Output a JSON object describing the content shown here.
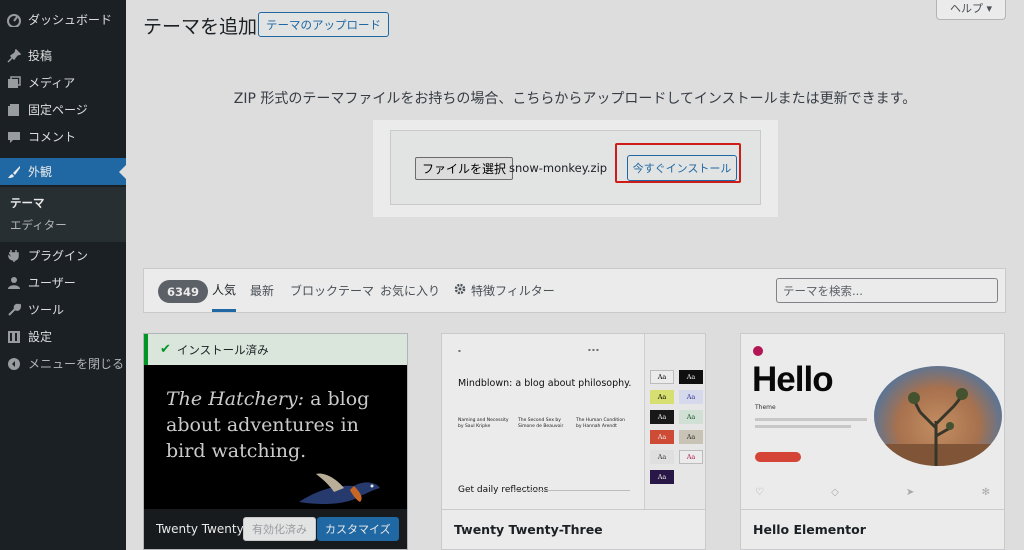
{
  "sidebar": {
    "items": [
      {
        "label": "ダッシュボード",
        "icon": "dashboard-icon"
      },
      {
        "label": "投稿",
        "icon": "pin-icon"
      },
      {
        "label": "メディア",
        "icon": "media-icon"
      },
      {
        "label": "固定ページ",
        "icon": "page-icon"
      },
      {
        "label": "コメント",
        "icon": "comment-icon"
      },
      {
        "label": "外観",
        "icon": "brush-icon"
      },
      {
        "label": "プラグイン",
        "icon": "plugin-icon"
      },
      {
        "label": "ユーザー",
        "icon": "user-icon"
      },
      {
        "label": "ツール",
        "icon": "wrench-icon"
      },
      {
        "label": "設定",
        "icon": "settings-icon"
      },
      {
        "label": "メニューを閉じる",
        "icon": "collapse-icon"
      }
    ],
    "submenu": [
      "テーマ",
      "エディター"
    ],
    "accent": "#2271b1"
  },
  "header": {
    "title": "テーマを追加",
    "upload_button": "テーマのアップロード",
    "help": "ヘルプ ▾"
  },
  "upload": {
    "description": "ZIP 形式のテーマファイルをお持ちの場合、こちらからアップロードしてインストールまたは更新できます。",
    "file_button": "ファイルを選択",
    "file_name": "snow-monkey.zip",
    "install_button": "今すぐインストール",
    "highlight_color": "#e0201b"
  },
  "filters": {
    "count": "6349",
    "tabs": [
      "人気",
      "最新",
      "ブロックテーマ",
      "お気に入り"
    ],
    "feature_filter": "特徴フィルター",
    "search_placeholder": "テーマを検索..."
  },
  "themes": [
    {
      "name": "Twenty Twenty-Fo",
      "installed_label": "インストール済み",
      "preview_italic": "The Hatchery:",
      "preview_rest": " a blog about adventures in bird watching.",
      "activated_button": "有効化済み",
      "customize_button": "カスタマイズ"
    },
    {
      "name": "Twenty Twenty-Three",
      "preview_headline": "Mindblown: a blog about philosophy.",
      "preview_posts": [
        "Naming and Necessity by Saul Kripke",
        "The Second Sex by Simone de Beauvoir",
        "The Human Condition by Hannah Arendt"
      ],
      "preview_footer": "Get daily reflections",
      "swatch": "Aa"
    },
    {
      "name": "Hello Elementor",
      "preview_title": "Hello",
      "preview_sub": "Theme"
    }
  ]
}
